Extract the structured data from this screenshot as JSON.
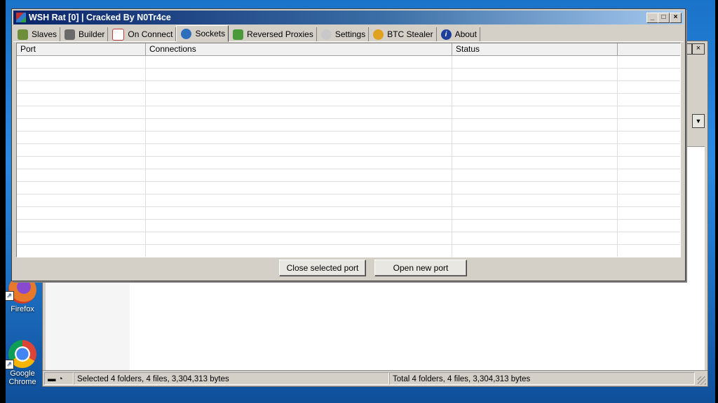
{
  "window": {
    "title": "WSH Rat [0] | Cracked By N0Tr4ce",
    "minimize": "_",
    "maximize": "□",
    "close": "×"
  },
  "tabs": [
    {
      "label": "Slaves",
      "icon": "users-icon",
      "color": "#6d8f3a"
    },
    {
      "label": "Builder",
      "icon": "hammer-icon",
      "color": "#6a6a6a"
    },
    {
      "label": "On Connect",
      "icon": "calendar-icon",
      "color": "#c04040"
    },
    {
      "label": "Sockets",
      "icon": "socket-icon",
      "color": "#2e6fbd"
    },
    {
      "label": "Reversed Proxies",
      "icon": "proxy-icon",
      "color": "#4a9a3a"
    },
    {
      "label": "Settings",
      "icon": "gear-icon",
      "color": "#9a9a9a"
    },
    {
      "label": "BTC Stealer",
      "icon": "bitcoin-icon",
      "color": "#e0a020"
    },
    {
      "label": "About",
      "icon": "info-icon",
      "color": "#1b3f9a"
    }
  ],
  "active_tab": "Sockets",
  "table": {
    "columns": [
      "Port",
      "Connections",
      "Status",
      ""
    ],
    "rows": []
  },
  "buttons": {
    "close_port": "Close selected port",
    "open_port": "Open new port"
  },
  "background_window": {
    "status_left": "Selected 4 folders, 4 files, 3,304,313 bytes",
    "status_right": "Total 4 folders, 4 files, 3,304,313 bytes"
  },
  "desktop_icons": [
    {
      "label": "Firefox"
    },
    {
      "label": "Google Chrome"
    }
  ],
  "colors": {
    "desktop": "#1d6fc2",
    "titlebar": "#0a246a",
    "window_face": "#d4d0c8"
  }
}
